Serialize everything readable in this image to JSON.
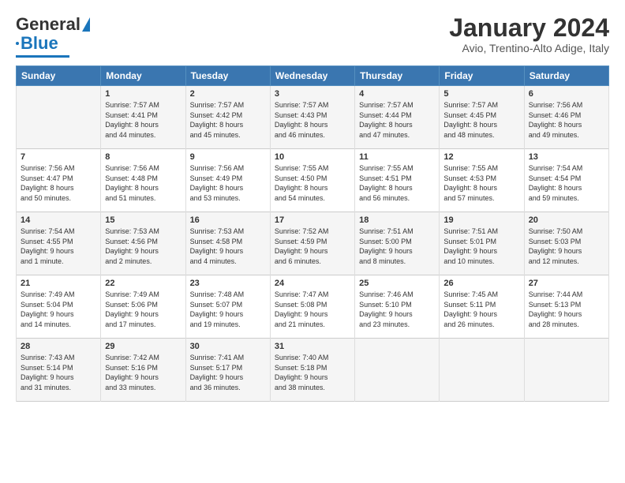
{
  "logo": {
    "general": "General",
    "blue": "Blue"
  },
  "title": "January 2024",
  "subtitle": "Avio, Trentino-Alto Adige, Italy",
  "days": [
    "Sunday",
    "Monday",
    "Tuesday",
    "Wednesday",
    "Thursday",
    "Friday",
    "Saturday"
  ],
  "weeks": [
    [
      {
        "day": "",
        "content": ""
      },
      {
        "day": "1",
        "content": "Sunrise: 7:57 AM\nSunset: 4:41 PM\nDaylight: 8 hours\nand 44 minutes."
      },
      {
        "day": "2",
        "content": "Sunrise: 7:57 AM\nSunset: 4:42 PM\nDaylight: 8 hours\nand 45 minutes."
      },
      {
        "day": "3",
        "content": "Sunrise: 7:57 AM\nSunset: 4:43 PM\nDaylight: 8 hours\nand 46 minutes."
      },
      {
        "day": "4",
        "content": "Sunrise: 7:57 AM\nSunset: 4:44 PM\nDaylight: 8 hours\nand 47 minutes."
      },
      {
        "day": "5",
        "content": "Sunrise: 7:57 AM\nSunset: 4:45 PM\nDaylight: 8 hours\nand 48 minutes."
      },
      {
        "day": "6",
        "content": "Sunrise: 7:56 AM\nSunset: 4:46 PM\nDaylight: 8 hours\nand 49 minutes."
      }
    ],
    [
      {
        "day": "7",
        "content": "Sunrise: 7:56 AM\nSunset: 4:47 PM\nDaylight: 8 hours\nand 50 minutes."
      },
      {
        "day": "8",
        "content": "Sunrise: 7:56 AM\nSunset: 4:48 PM\nDaylight: 8 hours\nand 51 minutes."
      },
      {
        "day": "9",
        "content": "Sunrise: 7:56 AM\nSunset: 4:49 PM\nDaylight: 8 hours\nand 53 minutes."
      },
      {
        "day": "10",
        "content": "Sunrise: 7:55 AM\nSunset: 4:50 PM\nDaylight: 8 hours\nand 54 minutes."
      },
      {
        "day": "11",
        "content": "Sunrise: 7:55 AM\nSunset: 4:51 PM\nDaylight: 8 hours\nand 56 minutes."
      },
      {
        "day": "12",
        "content": "Sunrise: 7:55 AM\nSunset: 4:53 PM\nDaylight: 8 hours\nand 57 minutes."
      },
      {
        "day": "13",
        "content": "Sunrise: 7:54 AM\nSunset: 4:54 PM\nDaylight: 8 hours\nand 59 minutes."
      }
    ],
    [
      {
        "day": "14",
        "content": "Sunrise: 7:54 AM\nSunset: 4:55 PM\nDaylight: 9 hours\nand 1 minute."
      },
      {
        "day": "15",
        "content": "Sunrise: 7:53 AM\nSunset: 4:56 PM\nDaylight: 9 hours\nand 2 minutes."
      },
      {
        "day": "16",
        "content": "Sunrise: 7:53 AM\nSunset: 4:58 PM\nDaylight: 9 hours\nand 4 minutes."
      },
      {
        "day": "17",
        "content": "Sunrise: 7:52 AM\nSunset: 4:59 PM\nDaylight: 9 hours\nand 6 minutes."
      },
      {
        "day": "18",
        "content": "Sunrise: 7:51 AM\nSunset: 5:00 PM\nDaylight: 9 hours\nand 8 minutes."
      },
      {
        "day": "19",
        "content": "Sunrise: 7:51 AM\nSunset: 5:01 PM\nDaylight: 9 hours\nand 10 minutes."
      },
      {
        "day": "20",
        "content": "Sunrise: 7:50 AM\nSunset: 5:03 PM\nDaylight: 9 hours\nand 12 minutes."
      }
    ],
    [
      {
        "day": "21",
        "content": "Sunrise: 7:49 AM\nSunset: 5:04 PM\nDaylight: 9 hours\nand 14 minutes."
      },
      {
        "day": "22",
        "content": "Sunrise: 7:49 AM\nSunset: 5:06 PM\nDaylight: 9 hours\nand 17 minutes."
      },
      {
        "day": "23",
        "content": "Sunrise: 7:48 AM\nSunset: 5:07 PM\nDaylight: 9 hours\nand 19 minutes."
      },
      {
        "day": "24",
        "content": "Sunrise: 7:47 AM\nSunset: 5:08 PM\nDaylight: 9 hours\nand 21 minutes."
      },
      {
        "day": "25",
        "content": "Sunrise: 7:46 AM\nSunset: 5:10 PM\nDaylight: 9 hours\nand 23 minutes."
      },
      {
        "day": "26",
        "content": "Sunrise: 7:45 AM\nSunset: 5:11 PM\nDaylight: 9 hours\nand 26 minutes."
      },
      {
        "day": "27",
        "content": "Sunrise: 7:44 AM\nSunset: 5:13 PM\nDaylight: 9 hours\nand 28 minutes."
      }
    ],
    [
      {
        "day": "28",
        "content": "Sunrise: 7:43 AM\nSunset: 5:14 PM\nDaylight: 9 hours\nand 31 minutes."
      },
      {
        "day": "29",
        "content": "Sunrise: 7:42 AM\nSunset: 5:16 PM\nDaylight: 9 hours\nand 33 minutes."
      },
      {
        "day": "30",
        "content": "Sunrise: 7:41 AM\nSunset: 5:17 PM\nDaylight: 9 hours\nand 36 minutes."
      },
      {
        "day": "31",
        "content": "Sunrise: 7:40 AM\nSunset: 5:18 PM\nDaylight: 9 hours\nand 38 minutes."
      },
      {
        "day": "",
        "content": ""
      },
      {
        "day": "",
        "content": ""
      },
      {
        "day": "",
        "content": ""
      }
    ]
  ]
}
